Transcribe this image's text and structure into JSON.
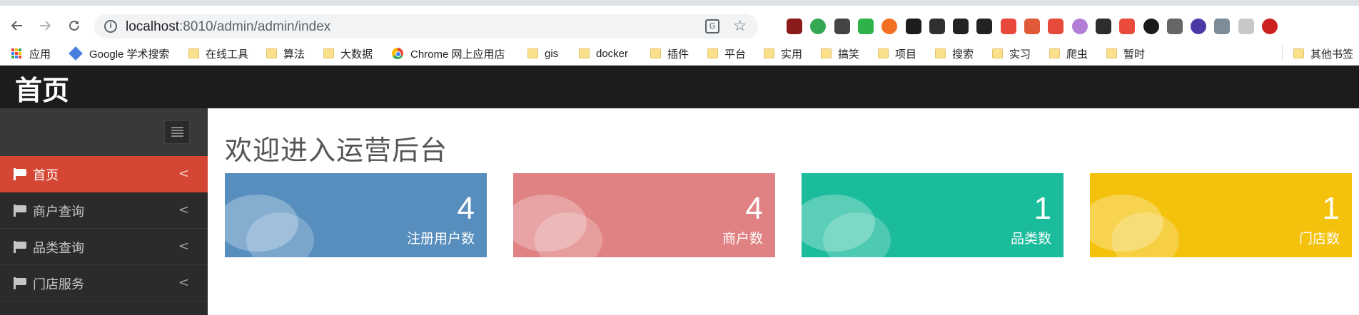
{
  "browser": {
    "url_host": "localhost",
    "url_rest": ":8010/admin/admin/index",
    "back_icon": "arrow-left-icon",
    "forward_icon": "arrow-right-icon",
    "reload_icon": "reload-icon",
    "extension_colors": [
      "#8b1a1a",
      "#34a853",
      "#444444",
      "#2db34a",
      "#f36f21",
      "#1c1c1c",
      "#303030",
      "#222222",
      "#222222",
      "#e8473b",
      "#e05a3a",
      "#e64a3b",
      "#b37fd6",
      "#2d2d2d",
      "#e94b3c",
      "#1a1a1a",
      "#666666",
      "#4a3aa8",
      "#7d8c97",
      "#c8c8c8",
      "#cc1f1f"
    ]
  },
  "bookmarks": {
    "apps": "应用",
    "items": [
      "Google 学术搜索",
      "在线工具",
      "算法",
      "大数据",
      "Chrome 网上应用店",
      "gis",
      "docker",
      "插件",
      "平台",
      "实用",
      "搞笑",
      "项目",
      "搜索",
      "实习",
      "爬虫",
      "暂时"
    ],
    "other": "其他书签"
  },
  "header": {
    "title": "首页"
  },
  "sidebar": {
    "items": [
      {
        "label": "首页",
        "active": true
      },
      {
        "label": "商户查询",
        "active": false
      },
      {
        "label": "品类查询",
        "active": false
      },
      {
        "label": "门店服务",
        "active": false
      }
    ]
  },
  "main": {
    "title": "欢迎进入运营后台",
    "stats": [
      {
        "value": "4",
        "label": "注册用户数",
        "color": "#578ebe"
      },
      {
        "value": "4",
        "label": "商户数",
        "color": "#e08283"
      },
      {
        "value": "1",
        "label": "品类数",
        "color": "#1bbc9b"
      },
      {
        "value": "1",
        "label": "门店数",
        "color": "#f4c20d"
      }
    ]
  },
  "colors": {
    "header_bg": "#1c1c1c",
    "sidebar_bg": "#2b2b2b",
    "sidebar_active": "#d64635"
  }
}
